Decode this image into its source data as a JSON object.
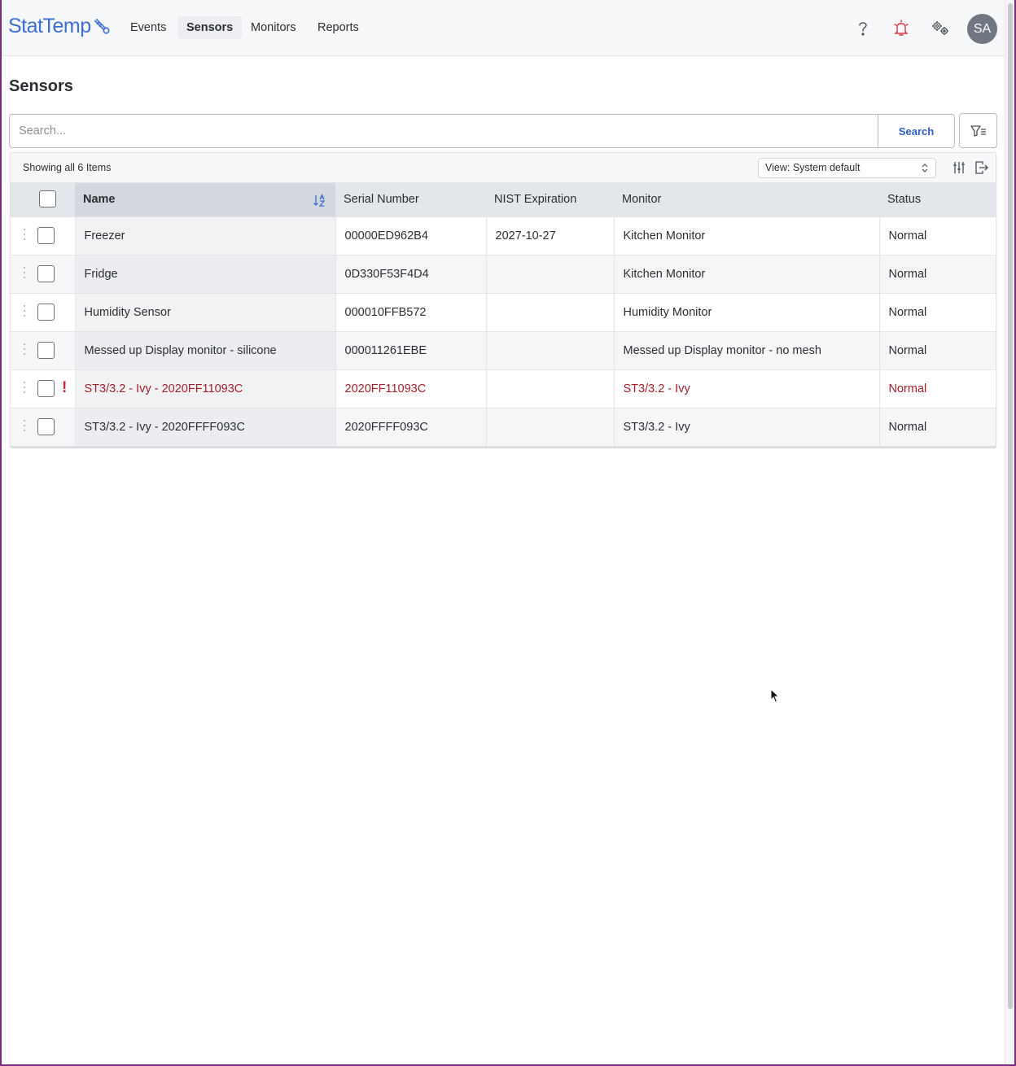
{
  "app": {
    "brand": "StatTemp",
    "nav": [
      {
        "label": "Events",
        "active": false
      },
      {
        "label": "Sensors",
        "active": true
      },
      {
        "label": "Monitors",
        "active": false
      },
      {
        "label": "Reports",
        "active": false
      }
    ],
    "icons": [
      "help-icon",
      "alarm-bell-icon",
      "settings-gears-icon"
    ],
    "avatar_initials": "SA",
    "accent_color": "#3d6fd1",
    "alert_color": "#a3202a"
  },
  "page": {
    "title": "Sensors",
    "search": {
      "placeholder": "Search...",
      "value": "",
      "button_label": "Search"
    }
  },
  "grid": {
    "summary": "Showing all 6 Items",
    "view_label": "View: System default",
    "columns": [
      "Name",
      "Serial Number",
      "NIST Expiration",
      "Monitor",
      "Status"
    ],
    "sorted_by": "Name",
    "rows": [
      {
        "name": "Freezer",
        "serial": "00000ED962B4",
        "nist": "2027-10-27",
        "monitor": "Kitchen Monitor",
        "status": "Normal",
        "alert": false
      },
      {
        "name": "Fridge",
        "serial": "0D330F53F4D4",
        "nist": "",
        "monitor": "Kitchen Monitor",
        "status": "Normal",
        "alert": false
      },
      {
        "name": "Humidity Sensor",
        "serial": "000010FFB572",
        "nist": "",
        "monitor": "Humidity Monitor",
        "status": "Normal",
        "alert": false
      },
      {
        "name": "Messed up Display monitor - silicone",
        "serial": "000011261EBE",
        "nist": "",
        "monitor": "Messed up Display monitor - no mesh",
        "status": "Normal",
        "alert": false
      },
      {
        "name": "ST3/3.2 - Ivy - 2020FF11093C",
        "serial": "2020FF11093C",
        "nist": "",
        "monitor": "ST3/3.2 - Ivy",
        "status": "Normal",
        "alert": true,
        "alert_mark": "!"
      },
      {
        "name": "ST3/3.2 - Ivy - 2020FFFF093C",
        "serial": "2020FFFF093C",
        "nist": "",
        "monitor": "ST3/3.2 - Ivy",
        "status": "Normal",
        "alert": false
      }
    ]
  }
}
